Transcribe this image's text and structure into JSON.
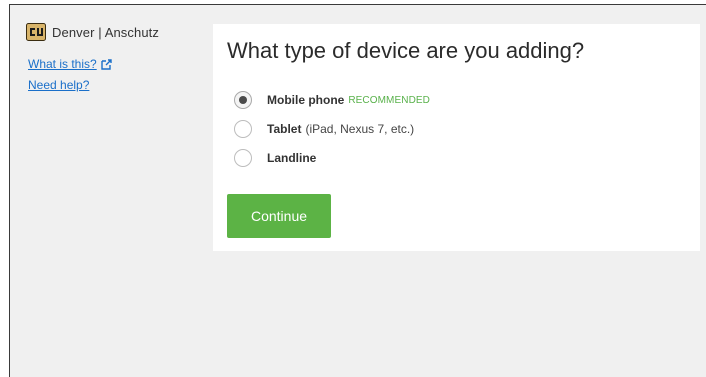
{
  "sidebar": {
    "brand_text": "Denver | Anschutz",
    "what_is_this": "What is this?",
    "need_help": "Need help?"
  },
  "main": {
    "title": "What type of device are you adding?",
    "options": [
      {
        "label": "Mobile phone",
        "tag": "RECOMMENDED",
        "detail": "",
        "selected": true
      },
      {
        "label": "Tablet",
        "tag": "",
        "detail": "(iPad, Nexus 7, etc.)",
        "selected": false
      },
      {
        "label": "Landline",
        "tag": "",
        "detail": "",
        "selected": false
      }
    ],
    "continue_label": "Continue"
  },
  "icons": {
    "brand": "cu-logo-icon",
    "external_link": "external-link-icon"
  },
  "colors": {
    "accent_green": "#5cb345",
    "recommended_green": "#58b14a",
    "link_blue": "#1a6fc9",
    "background": "#f0f0f0"
  }
}
